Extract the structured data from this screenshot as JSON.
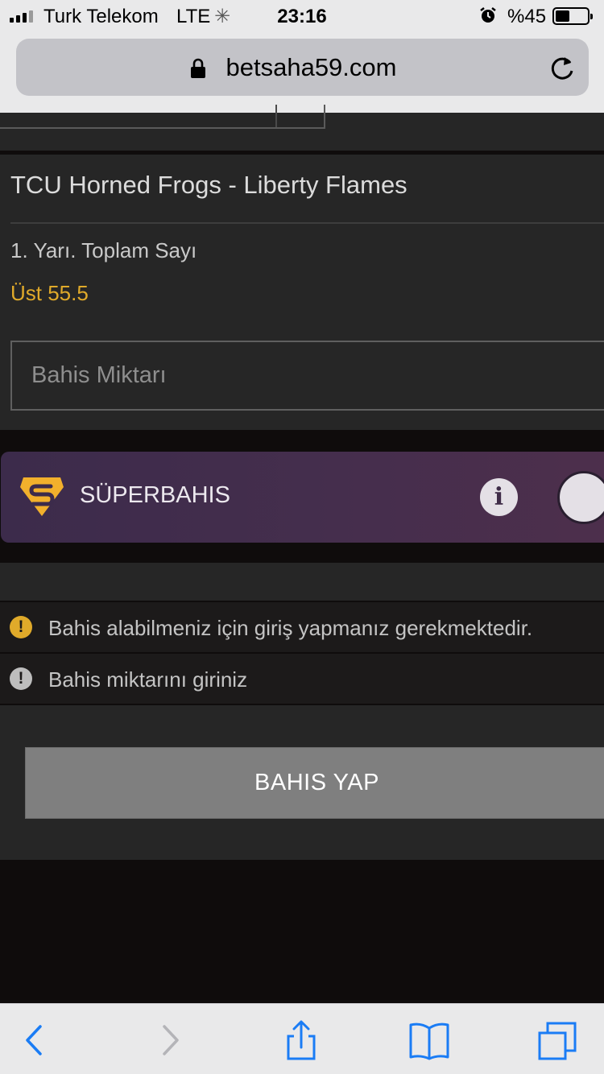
{
  "status_bar": {
    "carrier": "Turk Telekom",
    "network": "LTE",
    "time": "23:16",
    "battery_text": "%45",
    "battery_level": 0.45
  },
  "browser": {
    "url": "betsaha59.com"
  },
  "bet_slip": {
    "match": "TCU Horned Frogs - Liberty Flames",
    "market": "1. Yarı. Toplam Sayı",
    "selection": "Üst 55.5",
    "stake_placeholder": "Bahis Miktarı",
    "stake_value": ""
  },
  "superbahis": {
    "label": "SÜPERBAHIS",
    "info_icon_text": "i",
    "enabled": false
  },
  "messages": [
    {
      "icon": "warning-icon",
      "icon_text": "!",
      "text": "Bahis alabilmeniz için giriş yapmanız gerekmektedir."
    },
    {
      "icon": "info-alert-icon",
      "icon_text": "!",
      "text": "Bahis miktarını giriniz"
    }
  ],
  "action": {
    "place_bet_label": "BAHIS YAP"
  },
  "colors": {
    "accent_gold": "#e0aa2a",
    "ios_blue": "#1a7cf5",
    "panel": "#262626",
    "background": "#0f0c0c"
  }
}
